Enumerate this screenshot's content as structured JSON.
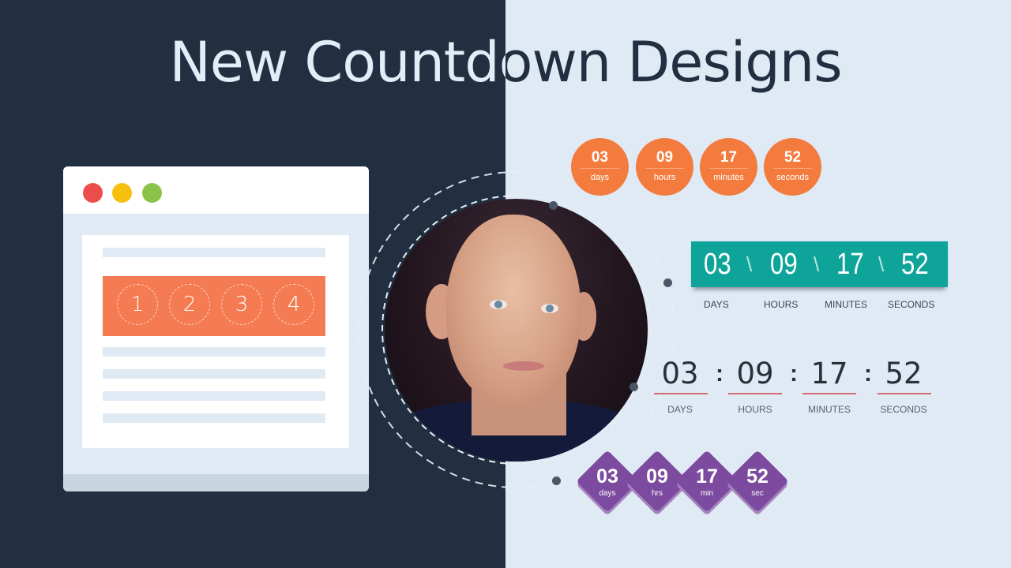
{
  "title": "New Countdown Designs",
  "colors": {
    "dark_bg": "#212f40",
    "light_bg": "#dfeaf5",
    "orange": "#f47b3e",
    "teal": "#0ea49a",
    "purple": "#7c4a9e",
    "underline_red": "#d46b6b"
  },
  "browser_mock": {
    "window_dots": [
      "red",
      "yellow",
      "green"
    ],
    "promo_numbers": [
      "1",
      "2",
      "3",
      "4"
    ]
  },
  "orange_circles": [
    {
      "value": "03",
      "label": "days"
    },
    {
      "value": "09",
      "label": "hours"
    },
    {
      "value": "17",
      "label": "minutes"
    },
    {
      "value": "52",
      "label": "seconds"
    }
  ],
  "teal_bar": {
    "values": [
      "03",
      "09",
      "17",
      "52"
    ],
    "separator": "\\",
    "labels": [
      "DAYS",
      "HOURS",
      "MINUTES",
      "SECONDS"
    ]
  },
  "underlined": {
    "values": [
      "03",
      "09",
      "17",
      "52"
    ],
    "separator": ":",
    "labels": [
      "DAYS",
      "HOURS",
      "MINUTES",
      "SECONDS"
    ]
  },
  "purple_diamonds": [
    {
      "value": "03",
      "label": "days"
    },
    {
      "value": "09",
      "label": "hrs"
    },
    {
      "value": "17",
      "label": "min"
    },
    {
      "value": "52",
      "label": "sec"
    }
  ]
}
